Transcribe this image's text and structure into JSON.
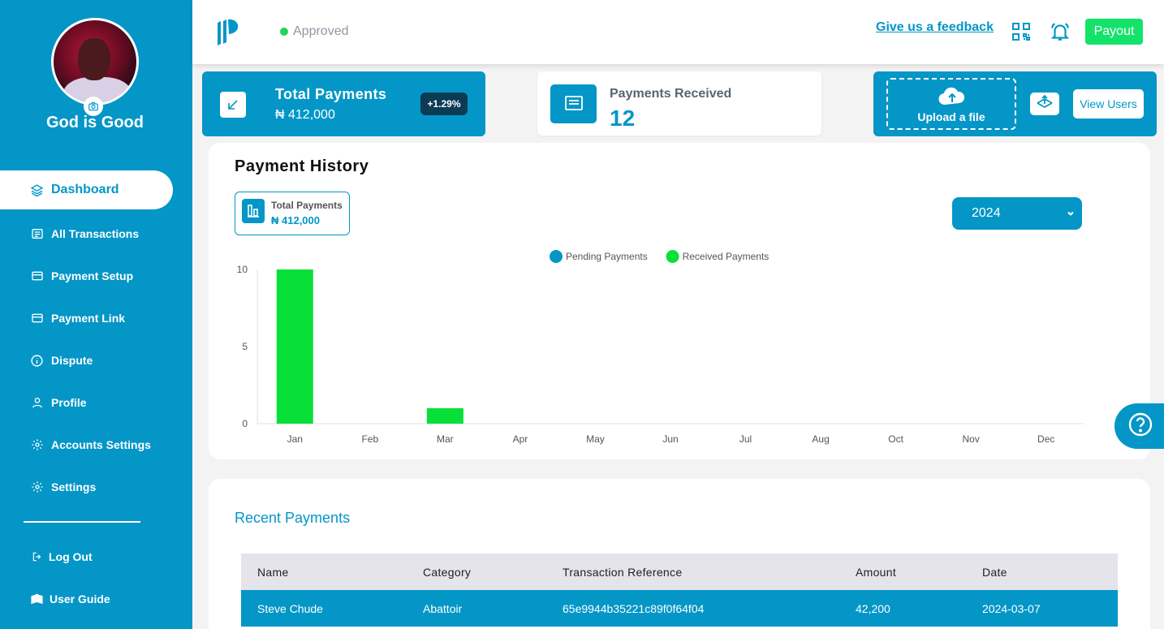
{
  "user": {
    "name": "God is Good"
  },
  "nav": {
    "items": [
      {
        "label": "Dashboard",
        "icon": "layers-icon",
        "active": true
      },
      {
        "label": "All Transactions",
        "icon": "list-icon"
      },
      {
        "label": "Payment Setup",
        "icon": "card-icon"
      },
      {
        "label": "Payment Link",
        "icon": "card-icon"
      },
      {
        "label": "Dispute",
        "icon": "info-icon"
      },
      {
        "label": "Profile",
        "icon": "user-icon"
      },
      {
        "label": "Accounts Settings",
        "icon": "gear-icon"
      },
      {
        "label": "Settings",
        "icon": "gear-icon"
      }
    ],
    "logout": "Log Out",
    "user_guide": "User Guide"
  },
  "topbar": {
    "status": "Approved",
    "feedback": "Give us a feedback",
    "payout": "Payout"
  },
  "cards": {
    "total_label": "Total Payments",
    "total_value": "₦ 412,000",
    "change": "+1.29%",
    "received_label": "Payments Received",
    "received_value": "12",
    "upload_label": "Upload a file",
    "view_users": "View Users"
  },
  "history": {
    "title": "Payment History",
    "tp_label": "Total Payments",
    "tp_value": "₦ 412,000",
    "year": "2024"
  },
  "chart_data": {
    "type": "bar",
    "categories": [
      "Jan",
      "Feb",
      "Mar",
      "Apr",
      "May",
      "Jun",
      "Jul",
      "Aug",
      "Oct",
      "Nov",
      "Dec"
    ],
    "series": [
      {
        "name": "Pending Payments",
        "color": "#0496c7",
        "values": [
          0,
          0,
          0,
          0,
          0,
          0,
          0,
          0,
          0,
          0,
          0
        ]
      },
      {
        "name": "Received Payments",
        "color": "#08e03a",
        "values": [
          10,
          0,
          1,
          0,
          0,
          0,
          0,
          0,
          0,
          0,
          0
        ]
      }
    ],
    "ylim": [
      0,
      10
    ],
    "yticks": [
      0,
      5,
      10
    ],
    "legend": "top-center",
    "grid": false
  },
  "recent": {
    "title": "Recent Payments",
    "columns": [
      "Name",
      "Category",
      "Transaction Reference",
      "Amount",
      "Date"
    ],
    "rows": [
      [
        "Steve Chude",
        "Abattoir",
        "65e9944b35221c89f0f64f04",
        "42,200",
        "2024-03-07"
      ]
    ]
  }
}
